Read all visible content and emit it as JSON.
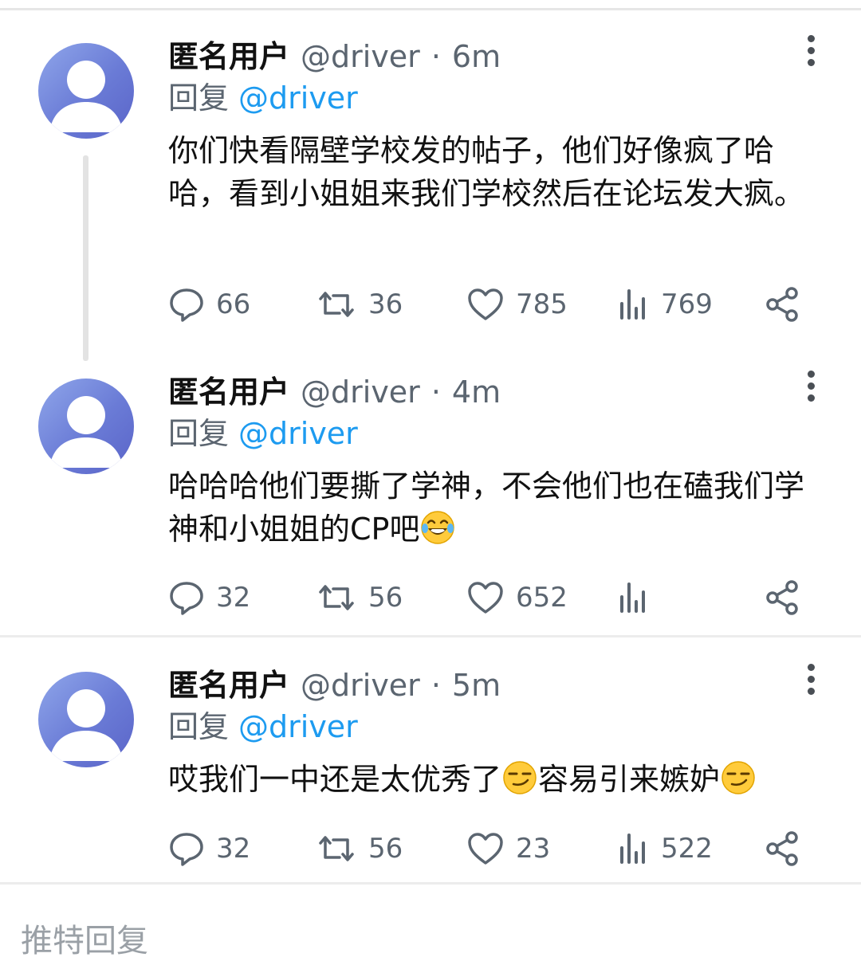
{
  "tweets": [
    {
      "name": "匿名用户",
      "handle": "@driver",
      "time": "6m",
      "reply_label": "回复",
      "reply_handle": "@driver",
      "text": "你们快看隔壁学校发的帖子，他们好像疯了哈哈，看到小姐姐来我们学校然后在论坛发大疯。",
      "replies": "66",
      "retweets": "36",
      "likes": "785",
      "views": "769"
    },
    {
      "name": "匿名用户",
      "handle": "@driver",
      "time": "4m",
      "reply_label": "回复",
      "reply_handle": "@driver",
      "text": "哈哈哈他们要撕了学神，不会他们也在磕我们学神和小姐姐的CP吧",
      "text_emoji": "tears-of-joy-emoji",
      "replies": "32",
      "retweets": "56",
      "likes": "652",
      "views": ""
    },
    {
      "name": "匿名用户",
      "handle": "@driver",
      "time": "5m",
      "reply_label": "回复",
      "reply_handle": "@driver",
      "text_part1": "哎我们一中还是太优秀了",
      "text_part2": "容易引来嫉妒",
      "text_emoji": "smirking-face-emoji",
      "replies": "32",
      "retweets": "56",
      "likes": "23",
      "views": "522"
    }
  ],
  "footer": {
    "title": "推特回复"
  },
  "colors": {
    "accent": "#1d9bf0",
    "muted": "#5b6570",
    "avatar": "#6a7bd6"
  },
  "icons": [
    "person-avatar-icon",
    "more-vertical-icon",
    "reply-icon",
    "retweet-icon",
    "like-icon",
    "views-icon",
    "share-icon"
  ]
}
